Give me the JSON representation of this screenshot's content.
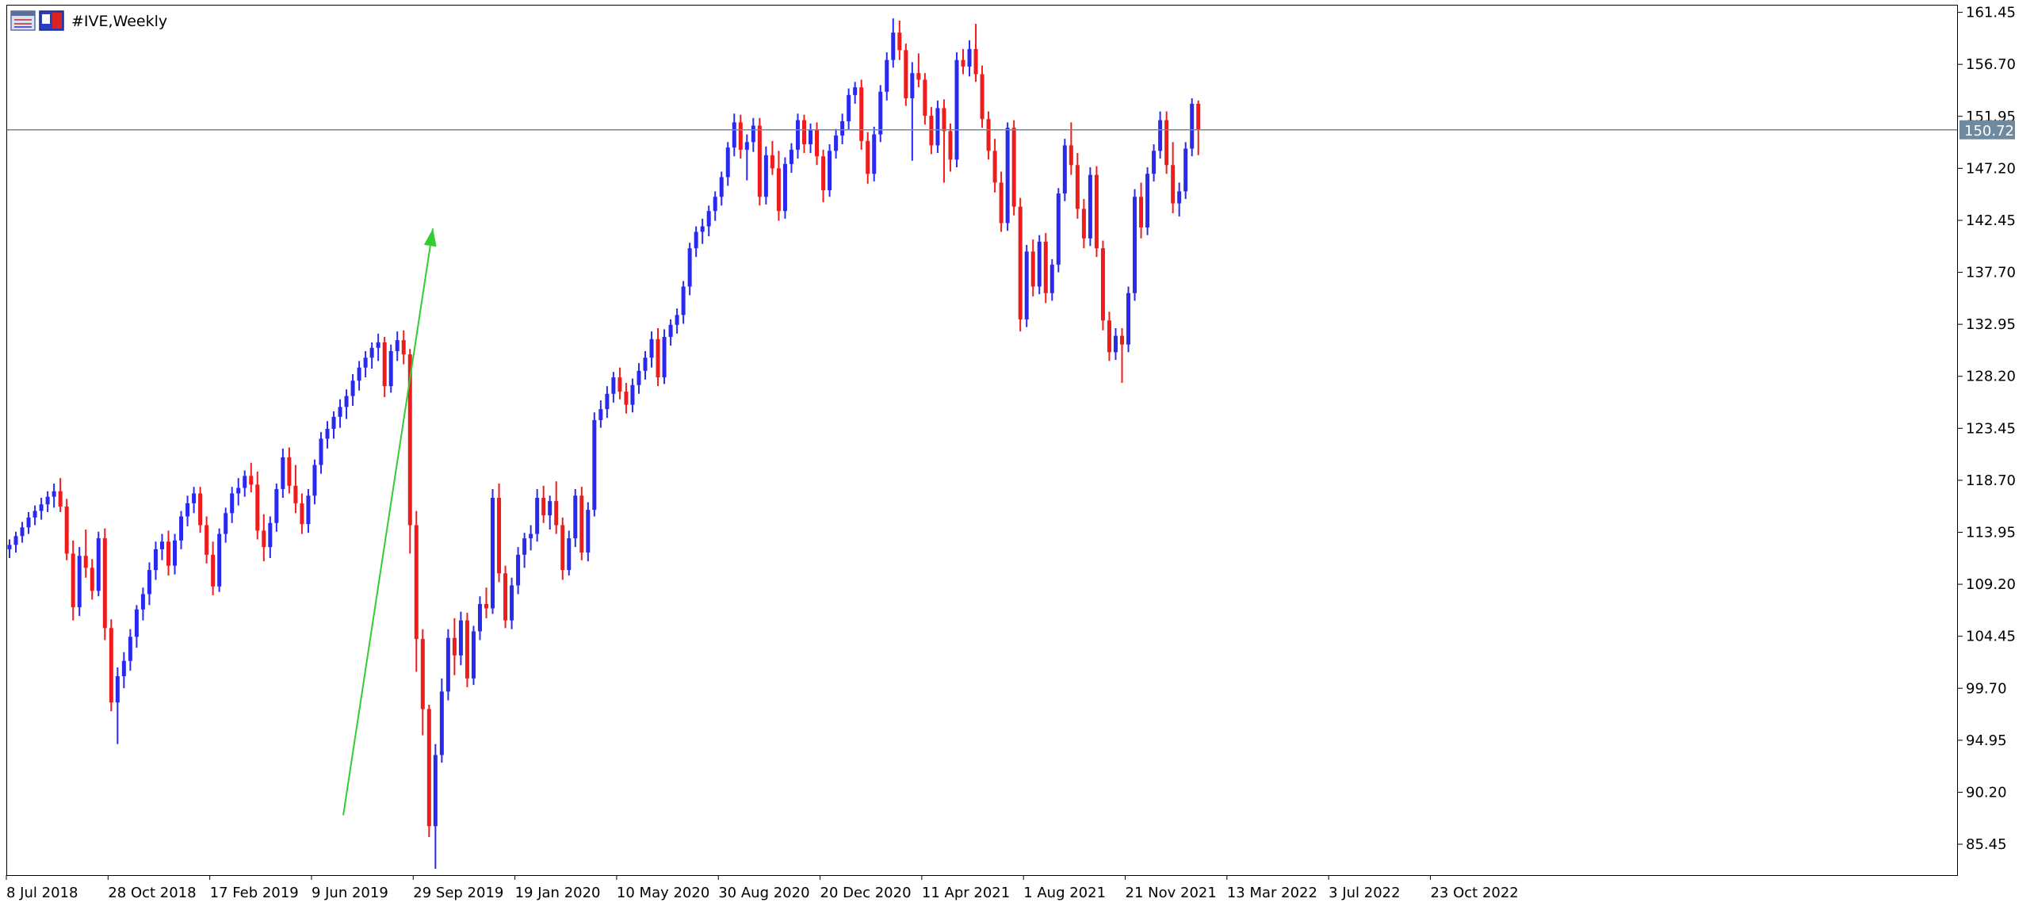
{
  "header": {
    "symbol_label": "#IVE,Weekly",
    "icons": [
      "chart-window-icon",
      "symbol-flag-icon"
    ]
  },
  "current_price": {
    "label": "150.72",
    "value": 150.72,
    "line_color": "#6f8a9e",
    "badge_color": "#6f8a9e"
  },
  "chart_data": {
    "type": "candlestick",
    "timeframe": "Weekly",
    "symbol": "#IVE",
    "ylim": [
      82.7,
      162.0
    ],
    "grid": false,
    "y_ticks": [
      "161.45",
      "156.70",
      "151.95",
      "147.20",
      "142.45",
      "137.70",
      "132.95",
      "128.20",
      "123.45",
      "118.70",
      "113.95",
      "109.20",
      "104.45",
      "99.70",
      "94.95",
      "90.20",
      "85.45"
    ],
    "x_ticks": [
      "8 Jul 2018",
      "28 Oct 2018",
      "17 Feb 2019",
      "9 Jun 2019",
      "29 Sep 2019",
      "19 Jan 2020",
      "10 May 2020",
      "30 Aug 2020",
      "20 Dec 2020",
      "11 Apr 2021",
      "1 Aug 2021",
      "21 Nov 2021",
      "13 Mar 2022",
      "3 Jul 2022",
      "23 Oct 2022"
    ],
    "colors": {
      "bull": "#2a2aee",
      "bear": "#ee1c1c",
      "trendline": "#33cc33"
    },
    "trendline": {
      "start": [
        52.5,
        88.1
      ],
      "end": [
        66.6,
        141.7
      ]
    },
    "candles": [
      [
        112.4,
        113.3,
        111.6,
        112.8
      ],
      [
        112.8,
        114.0,
        112.1,
        113.6
      ],
      [
        113.6,
        114.9,
        113.0,
        114.4
      ],
      [
        114.4,
        115.8,
        113.8,
        115.3
      ],
      [
        115.3,
        116.4,
        114.6,
        115.9
      ],
      [
        115.9,
        117.1,
        115.1,
        116.5
      ],
      [
        116.5,
        117.7,
        115.8,
        117.2
      ],
      [
        117.2,
        118.4,
        116.2,
        117.7
      ],
      [
        117.7,
        118.9,
        115.8,
        116.3
      ],
      [
        116.3,
        117.0,
        111.4,
        112.0
      ],
      [
        112.0,
        113.2,
        105.9,
        107.1
      ],
      [
        107.1,
        112.6,
        106.3,
        111.8
      ],
      [
        111.8,
        114.2,
        109.8,
        110.7
      ],
      [
        110.7,
        111.5,
        107.8,
        108.6
      ],
      [
        108.6,
        114.0,
        108.1,
        113.4
      ],
      [
        113.4,
        114.3,
        104.1,
        105.2
      ],
      [
        105.2,
        106.0,
        97.6,
        98.4
      ],
      [
        98.4,
        101.6,
        94.6,
        100.8
      ],
      [
        100.8,
        103.0,
        99.7,
        102.2
      ],
      [
        102.2,
        105.1,
        101.3,
        104.4
      ],
      [
        104.4,
        107.3,
        103.4,
        106.9
      ],
      [
        106.9,
        108.9,
        105.9,
        108.3
      ],
      [
        108.3,
        111.2,
        107.3,
        110.5
      ],
      [
        110.5,
        113.1,
        109.6,
        112.4
      ],
      [
        112.4,
        113.8,
        111.4,
        113.1
      ],
      [
        113.1,
        114.1,
        110.0,
        110.9
      ],
      [
        110.9,
        113.8,
        110.1,
        113.2
      ],
      [
        113.2,
        115.9,
        112.4,
        115.4
      ],
      [
        115.4,
        117.3,
        114.5,
        116.6
      ],
      [
        116.6,
        118.1,
        115.7,
        117.5
      ],
      [
        117.5,
        118.1,
        113.9,
        114.6
      ],
      [
        114.6,
        115.4,
        111.1,
        111.9
      ],
      [
        111.9,
        113.1,
        108.2,
        109.0
      ],
      [
        109.0,
        114.3,
        108.5,
        113.8
      ],
      [
        113.8,
        116.2,
        113.0,
        115.7
      ],
      [
        115.7,
        118.1,
        114.8,
        117.5
      ],
      [
        117.5,
        118.9,
        116.4,
        118.0
      ],
      [
        118.0,
        119.6,
        117.2,
        119.1
      ],
      [
        119.1,
        120.3,
        117.6,
        118.3
      ],
      [
        118.3,
        119.5,
        113.3,
        114.1
      ],
      [
        114.1,
        115.6,
        111.3,
        112.6
      ],
      [
        112.6,
        115.4,
        111.6,
        114.8
      ],
      [
        114.8,
        118.4,
        114.0,
        117.9
      ],
      [
        117.9,
        121.6,
        117.1,
        120.8
      ],
      [
        120.8,
        121.7,
        117.5,
        118.2
      ],
      [
        118.2,
        120.1,
        115.7,
        116.6
      ],
      [
        116.6,
        117.5,
        113.8,
        114.7
      ],
      [
        114.7,
        117.9,
        113.9,
        117.3
      ],
      [
        117.3,
        120.6,
        116.5,
        120.1
      ],
      [
        120.1,
        123.1,
        119.3,
        122.5
      ],
      [
        122.5,
        124.1,
        121.6,
        123.4
      ],
      [
        123.4,
        125.0,
        122.5,
        124.5
      ],
      [
        124.5,
        126.1,
        123.5,
        125.4
      ],
      [
        125.4,
        127.0,
        124.3,
        126.4
      ],
      [
        126.4,
        128.4,
        125.5,
        127.8
      ],
      [
        127.8,
        129.6,
        126.9,
        129.0
      ],
      [
        129.0,
        130.5,
        128.1,
        129.9
      ],
      [
        129.9,
        131.3,
        128.9,
        130.8
      ],
      [
        130.8,
        132.1,
        129.6,
        131.3
      ],
      [
        131.3,
        131.8,
        126.3,
        127.3
      ],
      [
        127.3,
        131.1,
        126.7,
        130.5
      ],
      [
        130.5,
        132.3,
        129.6,
        131.5
      ],
      [
        131.5,
        132.4,
        129.3,
        130.2
      ],
      [
        130.2,
        130.7,
        112.0,
        114.6
      ],
      [
        114.6,
        115.9,
        101.2,
        104.2
      ],
      [
        104.2,
        105.1,
        95.4,
        97.8
      ],
      [
        97.8,
        98.2,
        86.1,
        87.1
      ],
      [
        87.1,
        94.6,
        83.2,
        93.6
      ],
      [
        93.6,
        100.6,
        92.9,
        99.4
      ],
      [
        99.4,
        105.1,
        98.6,
        104.3
      ],
      [
        104.3,
        106.1,
        100.9,
        102.7
      ],
      [
        102.7,
        106.7,
        101.8,
        105.9
      ],
      [
        105.9,
        106.6,
        99.8,
        100.6
      ],
      [
        100.6,
        105.4,
        100.0,
        104.9
      ],
      [
        104.9,
        108.1,
        104.1,
        107.4
      ],
      [
        107.4,
        108.9,
        106.1,
        107.0
      ],
      [
        107.0,
        117.9,
        106.5,
        117.1
      ],
      [
        117.1,
        118.4,
        109.4,
        110.2
      ],
      [
        110.2,
        110.9,
        105.2,
        105.9
      ],
      [
        105.9,
        109.8,
        105.1,
        109.1
      ],
      [
        109.1,
        112.6,
        108.3,
        111.9
      ],
      [
        111.9,
        113.9,
        110.7,
        113.4
      ],
      [
        113.4,
        114.6,
        112.3,
        113.8
      ],
      [
        113.8,
        117.9,
        113.1,
        117.1
      ],
      [
        117.1,
        118.2,
        114.8,
        115.5
      ],
      [
        115.5,
        117.3,
        114.2,
        116.8
      ],
      [
        116.8,
        118.6,
        113.8,
        114.6
      ],
      [
        114.6,
        115.3,
        109.6,
        110.5
      ],
      [
        110.5,
        114.1,
        110.0,
        113.4
      ],
      [
        113.4,
        117.9,
        112.6,
        117.3
      ],
      [
        117.3,
        118.1,
        111.4,
        112.1
      ],
      [
        112.1,
        116.7,
        111.3,
        116.0
      ],
      [
        116.0,
        124.9,
        115.4,
        124.2
      ],
      [
        124.2,
        126.0,
        123.5,
        125.2
      ],
      [
        125.2,
        127.3,
        124.4,
        126.6
      ],
      [
        126.6,
        128.6,
        125.8,
        128.1
      ],
      [
        128.1,
        129.0,
        126.1,
        126.8
      ],
      [
        126.8,
        127.6,
        124.8,
        125.6
      ],
      [
        125.6,
        128.0,
        124.9,
        127.4
      ],
      [
        127.4,
        129.4,
        126.6,
        128.7
      ],
      [
        128.7,
        130.5,
        127.9,
        129.9
      ],
      [
        129.9,
        132.3,
        129.0,
        131.6
      ],
      [
        131.6,
        132.6,
        127.3,
        128.1
      ],
      [
        128.1,
        132.5,
        127.5,
        131.8
      ],
      [
        131.8,
        133.4,
        131.0,
        132.9
      ],
      [
        132.9,
        134.4,
        132.1,
        133.8
      ],
      [
        133.8,
        136.9,
        133.0,
        136.4
      ],
      [
        136.4,
        140.4,
        135.6,
        139.9
      ],
      [
        139.9,
        141.9,
        139.1,
        141.4
      ],
      [
        141.4,
        142.6,
        140.3,
        141.9
      ],
      [
        141.9,
        143.8,
        141.0,
        143.3
      ],
      [
        143.3,
        145.1,
        142.4,
        144.6
      ],
      [
        144.6,
        146.9,
        143.8,
        146.4
      ],
      [
        146.4,
        149.6,
        145.6,
        149.1
      ],
      [
        149.1,
        152.2,
        148.3,
        151.4
      ],
      [
        151.4,
        152.1,
        148.1,
        148.9
      ],
      [
        148.9,
        150.3,
        146.1,
        149.6
      ],
      [
        149.6,
        151.8,
        148.7,
        151.1
      ],
      [
        151.1,
        151.8,
        143.8,
        144.6
      ],
      [
        144.6,
        149.2,
        143.9,
        148.4
      ],
      [
        148.4,
        149.7,
        146.6,
        147.2
      ],
      [
        147.2,
        148.8,
        142.4,
        143.3
      ],
      [
        143.3,
        148.2,
        142.6,
        147.6
      ],
      [
        147.6,
        149.5,
        146.8,
        148.9
      ],
      [
        148.9,
        152.2,
        148.1,
        151.6
      ],
      [
        151.6,
        152.1,
        148.6,
        149.4
      ],
      [
        149.4,
        151.3,
        148.6,
        150.7
      ],
      [
        150.7,
        151.4,
        147.5,
        148.3
      ],
      [
        148.3,
        148.9,
        144.1,
        145.2
      ],
      [
        145.2,
        149.4,
        144.6,
        148.8
      ],
      [
        148.8,
        150.8,
        148.1,
        150.2
      ],
      [
        150.2,
        152.2,
        149.4,
        151.5
      ],
      [
        151.5,
        154.5,
        150.7,
        153.9
      ],
      [
        153.9,
        155.1,
        153.1,
        154.6
      ],
      [
        154.6,
        155.3,
        148.9,
        149.7
      ],
      [
        149.7,
        150.5,
        145.8,
        146.7
      ],
      [
        146.7,
        151.0,
        146.0,
        150.3
      ],
      [
        150.3,
        154.8,
        149.6,
        154.2
      ],
      [
        154.2,
        157.8,
        153.4,
        157.1
      ],
      [
        157.1,
        160.9,
        156.4,
        159.6
      ],
      [
        159.6,
        160.7,
        157.1,
        158.0
      ],
      [
        158.0,
        158.6,
        152.9,
        153.6
      ],
      [
        153.6,
        156.9,
        147.9,
        155.9
      ],
      [
        155.9,
        157.7,
        154.6,
        155.3
      ],
      [
        155.3,
        155.9,
        151.2,
        152.0
      ],
      [
        152.0,
        152.8,
        148.5,
        149.3
      ],
      [
        149.3,
        153.4,
        148.6,
        152.7
      ],
      [
        152.7,
        153.5,
        145.9,
        150.6
      ],
      [
        150.6,
        151.3,
        146.9,
        148.0
      ],
      [
        148.0,
        157.8,
        147.3,
        157.1
      ],
      [
        157.1,
        158.1,
        155.8,
        156.5
      ],
      [
        156.5,
        158.9,
        155.6,
        158.1
      ],
      [
        158.1,
        160.4,
        155.1,
        155.8
      ],
      [
        155.8,
        156.6,
        150.9,
        151.7
      ],
      [
        151.7,
        152.4,
        148.0,
        148.8
      ],
      [
        148.8,
        149.9,
        145.0,
        145.9
      ],
      [
        145.9,
        146.9,
        141.4,
        142.2
      ],
      [
        142.2,
        151.4,
        141.5,
        150.9
      ],
      [
        150.9,
        151.6,
        142.9,
        143.7
      ],
      [
        143.7,
        144.5,
        132.3,
        133.4
      ],
      [
        133.4,
        140.2,
        132.7,
        139.6
      ],
      [
        139.6,
        140.7,
        135.5,
        136.4
      ],
      [
        136.4,
        141.1,
        135.7,
        140.5
      ],
      [
        140.5,
        141.3,
        134.9,
        135.8
      ],
      [
        135.8,
        138.9,
        135.1,
        138.4
      ],
      [
        138.4,
        145.4,
        137.7,
        144.9
      ],
      [
        144.9,
        149.9,
        144.2,
        149.3
      ],
      [
        149.3,
        151.4,
        146.6,
        147.5
      ],
      [
        147.5,
        148.6,
        142.6,
        143.5
      ],
      [
        143.5,
        144.4,
        139.9,
        140.8
      ],
      [
        140.8,
        147.3,
        140.1,
        146.6
      ],
      [
        146.6,
        147.4,
        139.1,
        139.9
      ],
      [
        139.9,
        140.6,
        132.4,
        133.3
      ],
      [
        133.3,
        134.1,
        129.6,
        130.4
      ],
      [
        130.4,
        132.6,
        129.7,
        131.9
      ],
      [
        131.9,
        132.6,
        127.6,
        131.1
      ],
      [
        131.1,
        136.4,
        130.4,
        135.8
      ],
      [
        135.8,
        145.3,
        135.1,
        144.6
      ],
      [
        144.6,
        145.9,
        140.8,
        141.8
      ],
      [
        141.8,
        147.3,
        141.1,
        146.7
      ],
      [
        146.7,
        149.4,
        146.0,
        148.8
      ],
      [
        148.8,
        152.4,
        148.1,
        151.6
      ],
      [
        151.6,
        152.4,
        146.7,
        147.5
      ],
      [
        147.5,
        149.6,
        143.1,
        144.0
      ],
      [
        144.0,
        145.9,
        142.8,
        145.1
      ],
      [
        145.1,
        149.6,
        144.4,
        149.0
      ],
      [
        149.0,
        153.6,
        148.3,
        153.1
      ],
      [
        153.1,
        153.4,
        148.4,
        150.72
      ]
    ]
  }
}
